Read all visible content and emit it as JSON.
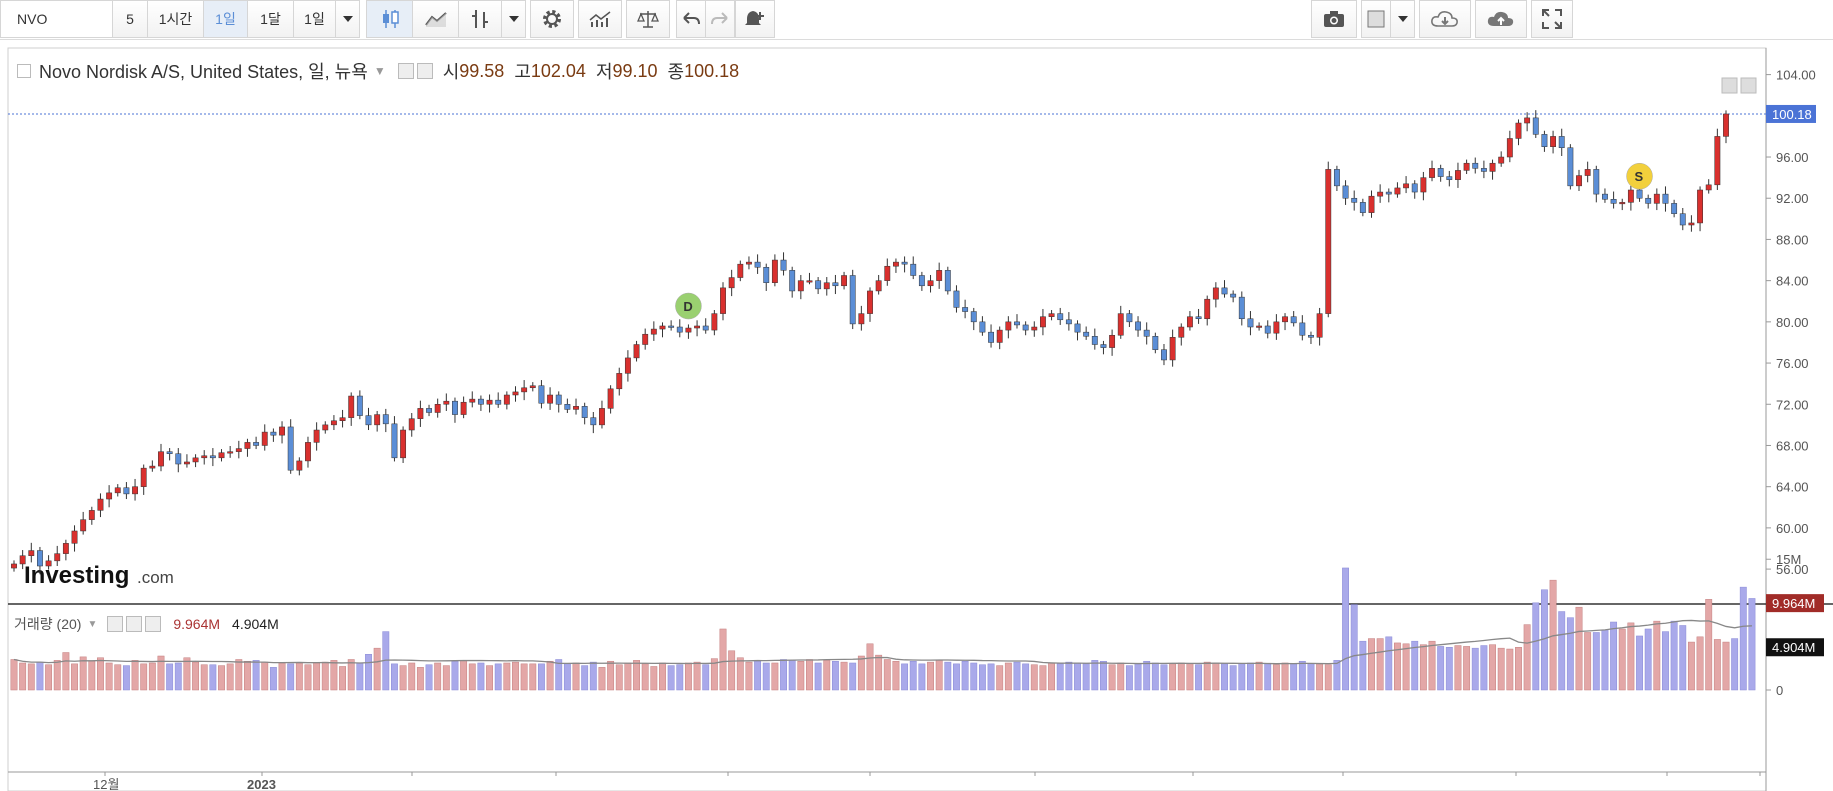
{
  "toolbar": {
    "symbol": "NVO",
    "buttons": [
      "5",
      "1시간",
      "1일",
      "1달",
      "1일"
    ],
    "active_index": 2,
    "icons": [
      "candles-icon",
      "line-chart-icon",
      "bar-type-icon",
      "dropdown-arrow-icon",
      "gear-icon",
      "indicators-icon",
      "compare-icon",
      "undo-icon",
      "redo-icon",
      "alert-add-icon",
      "camera-icon",
      "color-box-icon",
      "dropdown-arrow-icon",
      "cloud-download-icon",
      "cloud-upload-icon",
      "fullscreen-icon"
    ]
  },
  "legend": {
    "title": "Novo Nordisk A/S, United States, 일, 뉴욕",
    "open_label": "시",
    "open": "99.58",
    "high_label": "고",
    "high": "102.04",
    "low_label": "저",
    "low": "99.10",
    "close_label": "종",
    "close": "100.18"
  },
  "volume_legend": {
    "label": "거래량 (20)",
    "value1": "9.964M",
    "value2": "4.904M"
  },
  "watermark": {
    "brand": "Investing",
    "suffix": ".com"
  },
  "markers": [
    {
      "letter": "D",
      "color": "#9ad070"
    },
    {
      "letter": "S",
      "color": "#f2d03c"
    }
  ],
  "colors": {
    "up": "#d9302e",
    "down": "#5b8ed6",
    "vol_up": "#e3a7a7",
    "vol_down": "#a9a9ea",
    "last_price": "#4b73d6"
  },
  "chart_data": {
    "type": "candlestick",
    "price_axis": {
      "ticks": [
        "56.00",
        "60.00",
        "64.00",
        "68.00",
        "72.00",
        "76.00",
        "80.00",
        "84.00",
        "88.00",
        "92.00",
        "96.00",
        "100.18",
        "104.00"
      ],
      "last": "100.18"
    },
    "volume_axis": {
      "ticks": [
        "0",
        "4.904M",
        "9.964M",
        "15M"
      ]
    },
    "x_labels": [
      "12월",
      "2023"
    ],
    "price_range": [
      53,
      106
    ],
    "volume_max_m": 19.5,
    "closes": [
      56.5,
      57.3,
      57.8,
      56.3,
      56.8,
      57.5,
      58.5,
      59.7,
      60.8,
      61.7,
      62.8,
      63.4,
      63.9,
      63.3,
      64.0,
      65.8,
      66.0,
      67.4,
      67.2,
      66.2,
      66.4,
      66.8,
      67.0,
      66.8,
      67.3,
      67.4,
      67.7,
      68.3,
      68.0,
      69.3,
      69.0,
      69.8,
      65.6,
      66.5,
      68.3,
      69.5,
      70.0,
      70.4,
      70.7,
      72.8,
      70.9,
      70.0,
      71.0,
      70.1,
      66.8,
      69.5,
      70.6,
      71.6,
      71.2,
      72.0,
      72.3,
      71.0,
      72.2,
      72.5,
      72.0,
      72.4,
      72.0,
      72.9,
      73.2,
      73.6,
      73.8,
      72.1,
      72.9,
      72.0,
      71.5,
      71.8,
      70.7,
      70.0,
      71.6,
      73.5,
      75.0,
      76.5,
      77.8,
      78.8,
      79.3,
      79.6,
      79.5,
      79.0,
      79.4,
      79.6,
      79.2,
      80.8,
      83.3,
      84.3,
      85.6,
      85.8,
      85.3,
      83.8,
      86.0,
      85.0,
      83.0,
      84.0,
      84.0,
      83.2,
      83.8,
      83.5,
      84.5,
      79.8,
      80.8,
      83.0,
      84.0,
      85.4,
      85.8,
      85.6,
      84.5,
      83.5,
      84.0,
      85.0,
      83.0,
      81.4,
      81.0,
      80.0,
      79.0,
      78.0,
      79.2,
      80.0,
      79.7,
      79.2,
      79.5,
      80.5,
      80.8,
      80.2,
      79.8,
      79.0,
      78.6,
      77.8,
      77.5,
      78.7,
      80.8,
      80.0,
      79.2,
      78.6,
      77.3,
      76.3,
      78.5,
      79.5,
      80.5,
      80.3,
      82.2,
      83.3,
      82.7,
      82.4,
      80.3,
      79.5,
      79.6,
      78.9,
      80.0,
      80.5,
      79.9,
      78.7,
      78.5,
      80.8,
      94.8,
      93.2,
      92.0,
      91.6,
      90.6,
      92.2,
      92.6,
      92.4,
      93.0,
      93.4,
      92.6,
      94.0,
      94.9,
      94.1,
      93.8,
      94.7,
      95.4,
      94.9,
      94.6,
      95.4,
      96.0,
      97.8,
      99.3,
      99.8,
      98.2,
      97.0,
      98.0,
      96.9,
      93.2,
      94.2,
      94.8,
      92.4,
      91.9,
      91.5,
      91.6,
      92.8,
      92.0,
      91.5,
      92.4,
      91.5,
      90.5,
      89.4,
      89.6,
      92.8,
      93.3,
      98.0,
      100.18
    ],
    "volumes_m": [
      3.5,
      3.1,
      3.0,
      3.2,
      2.9,
      3.4,
      4.3,
      3.0,
      3.8,
      3.3,
      3.7,
      3.1,
      2.9,
      2.8,
      3.4,
      3.0,
      3.1,
      3.9,
      3.0,
      3.1,
      3.7,
      3.2,
      2.9,
      2.9,
      2.8,
      3.0,
      3.5,
      3.3,
      3.4,
      3.2,
      2.6,
      3.1,
      3.0,
      3.1,
      2.9,
      3.1,
      3.2,
      3.4,
      2.7,
      3.5,
      3.1,
      4.1,
      4.8,
      6.7,
      3.0,
      2.8,
      3.1,
      2.6,
      2.9,
      3.1,
      2.8,
      3.3,
      3.4,
      3.0,
      3.1,
      2.8,
      3.0,
      3.1,
      3.2,
      3.0,
      3.0,
      3.0,
      3.3,
      3.5,
      3.0,
      3.1,
      2.8,
      3.2,
      2.6,
      3.3,
      2.9,
      3.1,
      3.4,
      3.0,
      2.7,
      3.1,
      2.8,
      2.9,
      3.1,
      3.2,
      2.9,
      3.6,
      7.0,
      4.5,
      3.7,
      3.2,
      3.3,
      3.1,
      3.1,
      3.5,
      3.4,
      3.3,
      3.5,
      3.1,
      3.4,
      3.3,
      3.2,
      3.1,
      3.9,
      5.3,
      4.0,
      3.5,
      3.3,
      3.0,
      3.3,
      3.0,
      3.2,
      3.4,
      3.2,
      3.0,
      3.3,
      3.1,
      2.9,
      3.0,
      2.8,
      3.1,
      3.2,
      3.0,
      2.9,
      2.8,
      3.1,
      3.0,
      3.2,
      3.1,
      3.0,
      3.4,
      3.3,
      2.9,
      3.1,
      2.8,
      3.0,
      3.3,
      3.1,
      2.9,
      3.0,
      3.1,
      3.0,
      2.9,
      3.2,
      3.1,
      3.0,
      2.8,
      3.0,
      3.1,
      3.2,
      3.0,
      2.9,
      3.1,
      3.0,
      3.3,
      3.0,
      3.0,
      2.9,
      3.4,
      14.0,
      9.8,
      5.6,
      5.9,
      5.9,
      6.1,
      5.4,
      5.3,
      5.6,
      5.2,
      5.6,
      5.0,
      4.9,
      5.1,
      5.0,
      4.8,
      5.1,
      5.2,
      4.8,
      4.7,
      4.9,
      7.5,
      10.0,
      11.5,
      12.6,
      9.0,
      8.3,
      9.5,
      6.6,
      6.6,
      6.9,
      7.8,
      7.0,
      7.7,
      6.2,
      7.0,
      7.9,
      6.7,
      7.9,
      7.4,
      5.5,
      6.1,
      10.4,
      5.8,
      5.5,
      5.9,
      11.8,
      10.5
    ],
    "marker_positions": [
      {
        "index": 78,
        "label": "D"
      },
      {
        "index": 188,
        "label": "S"
      }
    ]
  }
}
